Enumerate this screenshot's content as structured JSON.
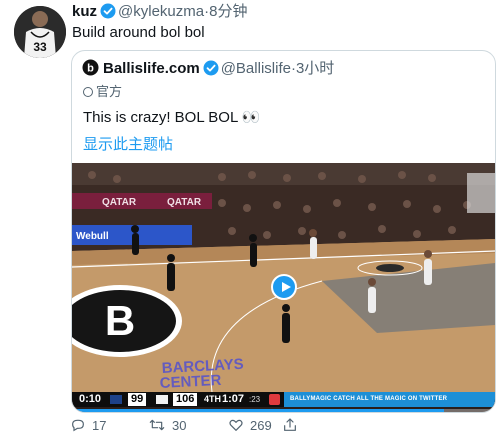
{
  "tweet": {
    "author_name": "kuz",
    "handle": "@kylekuzma",
    "separator": "·",
    "time": "8分钟",
    "text": "Build around bol bol",
    "avatar_jersey_number": "33"
  },
  "quote": {
    "author_name": "Ballislife.com",
    "handle": "@Ballislife",
    "separator": "·",
    "time": "3小时",
    "label": "官方",
    "text": "This is crazy! BOL BOL 👀",
    "show_thread_link": "显示此主题帖"
  },
  "video": {
    "arena_text_line1": "BARCLAYS",
    "arena_text_line2": "CENTER",
    "sponsor_1": "QATAR",
    "sponsor_2": "QATAR",
    "sponsor_3": "Webull",
    "scorebug": {
      "clock": "0:10",
      "home_score": "99",
      "away_score": "106",
      "quarter": "4TH",
      "game_clock": "1:07",
      "shot_clock": ":23",
      "ad_text": "BALLYMAGIC  CATCH ALL THE MAGIC ON TWITTER"
    },
    "progress_fraction": 0.88
  },
  "actions": {
    "reply_count": "17",
    "retweet_count": "30",
    "like_count": "269"
  },
  "colors": {
    "accent": "#1d9bf0",
    "text_primary": "#0f1419",
    "text_secondary": "#536471",
    "border": "#cfd9de"
  }
}
